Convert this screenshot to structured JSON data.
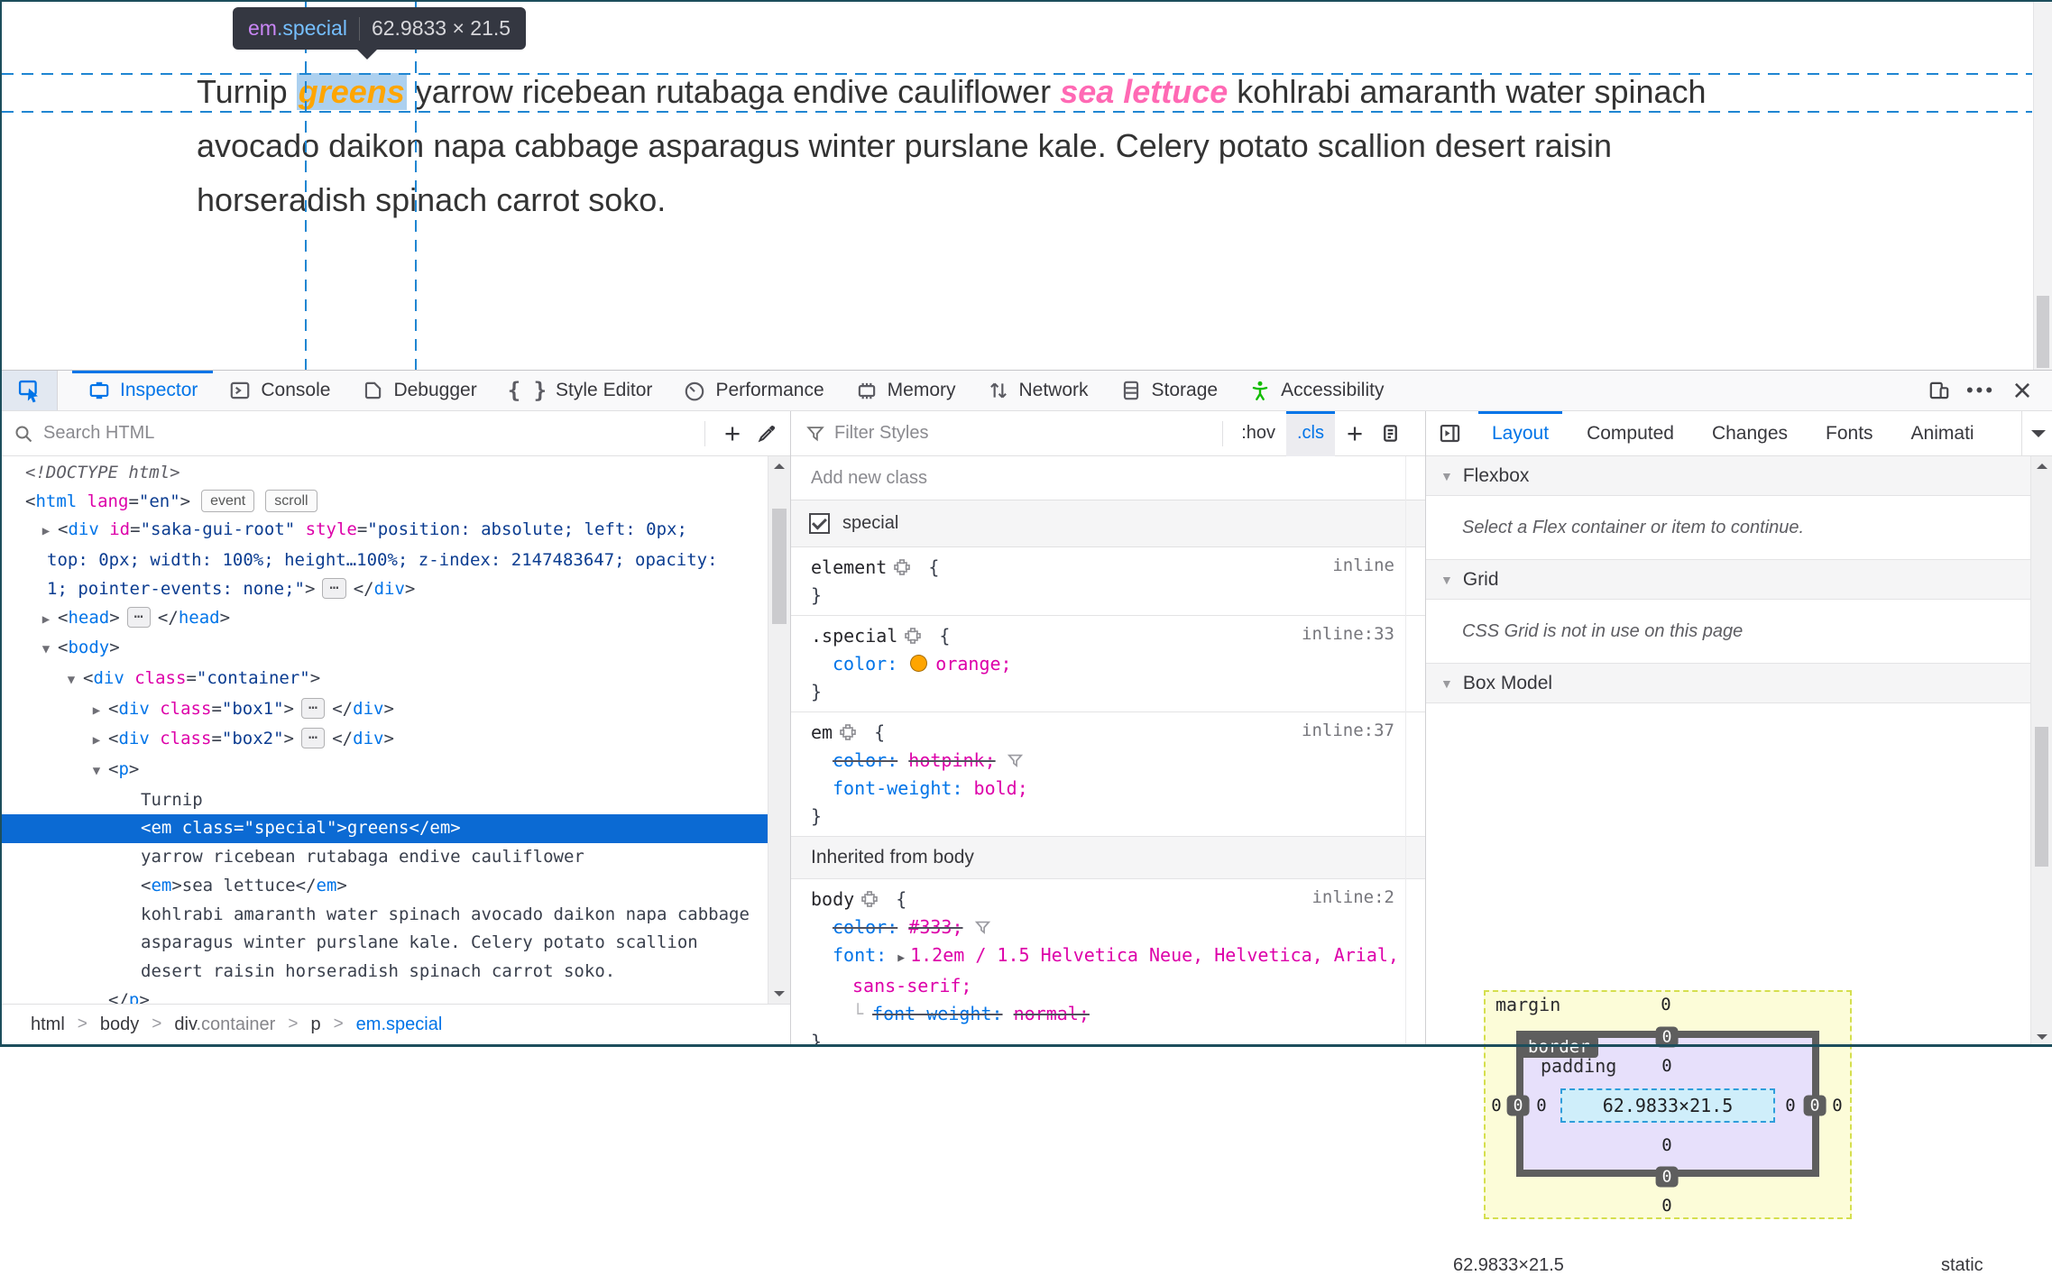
{
  "colors": {
    "accent": "#0074e8",
    "selection_bg": "#0b6ad3",
    "guide_blue": "#1f86d2",
    "tag": "#0074e8",
    "attr_name": "#dd00a9",
    "attr_value": "#0c3d91",
    "prop_name": "#0074e8",
    "prop_value": "#dd00a9",
    "orange_swatch": "#ffa500",
    "hotpink_text": "#ff69b4",
    "special_text": "#ffa500",
    "body_text": "#333333",
    "accessibility_green": "#12bc00",
    "bm_margin_fill": "#fcfcd8",
    "bm_border_fill": "#5e5e5e",
    "bm_padding_fill": "#e7e0fb",
    "bm_content_fill": "#cfeefa"
  },
  "page": {
    "tooltip": {
      "tag": "em",
      "cls": ".special",
      "dims": "62.9833 × 21.5"
    },
    "text_lines": [
      {
        "segments": [
          {
            "t": "Turnip ",
            "c": "plain"
          },
          {
            "t": "greens",
            "c": "special"
          },
          {
            "t": " yarrow ricebean rutabaga endive cauliflower ",
            "c": "plain"
          },
          {
            "t": "sea lettuce",
            "c": "em"
          },
          {
            "t": " kohlrabi amaranth water spinach",
            "c": "plain"
          }
        ]
      },
      {
        "segments": [
          {
            "t": "avocado daikon napa cabbage asparagus winter purslane kale. Celery potato scallion desert raisin",
            "c": "plain"
          }
        ]
      },
      {
        "segments": [
          {
            "t": "horseradish spinach carrot soko.",
            "c": "plain"
          }
        ]
      }
    ]
  },
  "toolbar": {
    "tabs": [
      {
        "id": "inspector",
        "label": "Inspector",
        "icon": "inspector-icon",
        "active": true
      },
      {
        "id": "console",
        "label": "Console",
        "icon": "console-icon"
      },
      {
        "id": "debugger",
        "label": "Debugger",
        "icon": "debugger-icon"
      },
      {
        "id": "style-editor",
        "label": "Style Editor",
        "icon": "style-editor-icon"
      },
      {
        "id": "performance",
        "label": "Performance",
        "icon": "performance-icon"
      },
      {
        "id": "memory",
        "label": "Memory",
        "icon": "memory-icon"
      },
      {
        "id": "network",
        "label": "Network",
        "icon": "network-icon"
      },
      {
        "id": "storage",
        "label": "Storage",
        "icon": "storage-icon"
      },
      {
        "id": "accessibility",
        "label": "Accessibility",
        "icon": "accessibility-icon",
        "icon_color": "#12bc00"
      }
    ],
    "right_icons": [
      {
        "name": "responsive-mode-icon"
      },
      {
        "name": "menu-icon",
        "glyph": "•••"
      },
      {
        "name": "close-icon",
        "glyph": "×"
      }
    ]
  },
  "markup": {
    "search_placeholder": "Search HTML",
    "add_node_label": "+",
    "rows": [
      {
        "i": 0,
        "s": [
          {
            "c": "d",
            "t": "<!DOCTYPE html>"
          }
        ]
      },
      {
        "i": 0,
        "s": [
          {
            "c": "p",
            "t": "<"
          },
          {
            "c": "t",
            "t": "html"
          },
          {
            "c": "p",
            "t": " "
          },
          {
            "c": "a",
            "t": "lang"
          },
          {
            "c": "p",
            "t": "="
          },
          {
            "c": "v",
            "t": "\"en\""
          },
          {
            "c": "p",
            "t": ">"
          },
          {
            "c": "b",
            "t": "event"
          },
          {
            "c": "b",
            "t": "scroll"
          }
        ]
      },
      {
        "i": 1,
        "tw": "c",
        "s": [
          {
            "c": "p",
            "t": "<"
          },
          {
            "c": "t",
            "t": "div"
          },
          {
            "c": "p",
            "t": " "
          },
          {
            "c": "a",
            "t": "id"
          },
          {
            "c": "p",
            "t": "="
          },
          {
            "c": "v",
            "t": "\"saka-gui-root\""
          },
          {
            "c": "p",
            "t": " "
          },
          {
            "c": "a",
            "t": "style"
          },
          {
            "c": "p",
            "t": "="
          },
          {
            "c": "v",
            "t": "\"position: absolute; left: 0px;"
          }
        ]
      },
      {
        "i": "w",
        "s": [
          {
            "c": "v",
            "t": "top: 0px; width: 100%; height…100%; z-index: 2147483647; opacity:"
          }
        ]
      },
      {
        "i": "w",
        "s": [
          {
            "c": "v",
            "t": "1; pointer-events: none;\""
          },
          {
            "c": "p",
            "t": ">"
          },
          {
            "c": "e",
            "t": "⋯"
          },
          {
            "c": "p",
            "t": "</"
          },
          {
            "c": "t",
            "t": "div"
          },
          {
            "c": "p",
            "t": ">"
          }
        ]
      },
      {
        "i": 1,
        "tw": "c",
        "s": [
          {
            "c": "p",
            "t": "<"
          },
          {
            "c": "t",
            "t": "head"
          },
          {
            "c": "p",
            "t": ">"
          },
          {
            "c": "e",
            "t": "⋯"
          },
          {
            "c": "p",
            "t": "</"
          },
          {
            "c": "t",
            "t": "head"
          },
          {
            "c": "p",
            "t": ">"
          }
        ]
      },
      {
        "i": 1,
        "tw": "e",
        "s": [
          {
            "c": "p",
            "t": "<"
          },
          {
            "c": "t",
            "t": "body"
          },
          {
            "c": "p",
            "t": ">"
          }
        ]
      },
      {
        "i": 2,
        "tw": "e",
        "s": [
          {
            "c": "p",
            "t": "<"
          },
          {
            "c": "t",
            "t": "div"
          },
          {
            "c": "p",
            "t": " "
          },
          {
            "c": "a",
            "t": "class"
          },
          {
            "c": "p",
            "t": "="
          },
          {
            "c": "v",
            "t": "\"container\""
          },
          {
            "c": "p",
            "t": ">"
          }
        ]
      },
      {
        "i": 3,
        "tw": "c",
        "s": [
          {
            "c": "p",
            "t": "<"
          },
          {
            "c": "t",
            "t": "div"
          },
          {
            "c": "p",
            "t": " "
          },
          {
            "c": "a",
            "t": "class"
          },
          {
            "c": "p",
            "t": "="
          },
          {
            "c": "v",
            "t": "\"box1\""
          },
          {
            "c": "p",
            "t": ">"
          },
          {
            "c": "e",
            "t": "⋯"
          },
          {
            "c": "p",
            "t": "</"
          },
          {
            "c": "t",
            "t": "div"
          },
          {
            "c": "p",
            "t": ">"
          }
        ]
      },
      {
        "i": 3,
        "tw": "c",
        "s": [
          {
            "c": "p",
            "t": "<"
          },
          {
            "c": "t",
            "t": "div"
          },
          {
            "c": "p",
            "t": " "
          },
          {
            "c": "a",
            "t": "class"
          },
          {
            "c": "p",
            "t": "="
          },
          {
            "c": "v",
            "t": "\"box2\""
          },
          {
            "c": "p",
            "t": ">"
          },
          {
            "c": "e",
            "t": "⋯"
          },
          {
            "c": "p",
            "t": "</"
          },
          {
            "c": "t",
            "t": "div"
          },
          {
            "c": "p",
            "t": ">"
          }
        ]
      },
      {
        "i": 3,
        "tw": "e",
        "s": [
          {
            "c": "p",
            "t": "<"
          },
          {
            "c": "t",
            "t": "p"
          },
          {
            "c": "p",
            "t": ">"
          }
        ]
      },
      {
        "i": 4,
        "s": [
          {
            "c": "x",
            "t": "Turnip"
          }
        ]
      },
      {
        "i": 4,
        "sel": true,
        "s": [
          {
            "c": "p",
            "t": "<"
          },
          {
            "c": "t",
            "t": "em"
          },
          {
            "c": "p",
            "t": " "
          },
          {
            "c": "a",
            "t": "class"
          },
          {
            "c": "p",
            "t": "="
          },
          {
            "c": "v",
            "t": "\"special\""
          },
          {
            "c": "p",
            "t": ">"
          },
          {
            "c": "x",
            "t": "greens"
          },
          {
            "c": "p",
            "t": "</"
          },
          {
            "c": "t",
            "t": "em"
          },
          {
            "c": "p",
            "t": ">"
          }
        ]
      },
      {
        "i": 4,
        "s": [
          {
            "c": "x",
            "t": "yarrow ricebean rutabaga endive cauliflower"
          }
        ]
      },
      {
        "i": 4,
        "s": [
          {
            "c": "p",
            "t": "<"
          },
          {
            "c": "t",
            "t": "em"
          },
          {
            "c": "p",
            "t": ">"
          },
          {
            "c": "x",
            "t": "sea lettuce"
          },
          {
            "c": "p",
            "t": "</"
          },
          {
            "c": "t",
            "t": "em"
          },
          {
            "c": "p",
            "t": ">"
          }
        ]
      },
      {
        "i": 4,
        "s": [
          {
            "c": "x",
            "t": "kohlrabi amaranth water spinach avocado daikon napa cabbage"
          }
        ]
      },
      {
        "i": 4,
        "s": [
          {
            "c": "x",
            "t": "asparagus winter purslane kale. Celery potato scallion"
          }
        ]
      },
      {
        "i": 4,
        "s": [
          {
            "c": "x",
            "t": "desert raisin horseradish spinach carrot soko."
          }
        ]
      },
      {
        "i": 3,
        "s": [
          {
            "c": "p",
            "t": "</"
          },
          {
            "c": "t",
            "t": "p"
          },
          {
            "c": "p",
            "t": ">"
          }
        ]
      }
    ]
  },
  "breadcrumbs": [
    {
      "label": "html"
    },
    {
      "label": "body"
    },
    {
      "label": "div",
      "suffix": ".container"
    },
    {
      "label": "p"
    },
    {
      "label": "em.special",
      "active": true
    }
  ],
  "styles": {
    "filter_placeholder": "Filter Styles",
    "pseudo_toggle": ":hov",
    "class_toggle": ".cls",
    "new_rule_label": "+",
    "add_class_placeholder": "Add new class",
    "class_checkbox": {
      "label": "special",
      "checked": true
    },
    "rules": [
      {
        "selector": "element",
        "location": "inline",
        "decls": []
      },
      {
        "selector": ".special",
        "location": "inline:33",
        "decls": [
          {
            "name": "color",
            "value": "orange;",
            "swatch": "#ffa500"
          }
        ]
      },
      {
        "selector": "em",
        "location": "inline:37",
        "decls": [
          {
            "name": "color",
            "value": "hotpink;",
            "struck": true,
            "funnel": true
          },
          {
            "name": "font-weight",
            "value": "bold;"
          }
        ]
      }
    ],
    "inherited": {
      "header": "Inherited from body",
      "rules": [
        {
          "selector": "body",
          "location": "inline:2",
          "decls": [
            {
              "name": "color",
              "value": "#333;",
              "struck": true,
              "funnel": true
            },
            {
              "name": "font",
              "value": "1.2em / 1.5 Helvetica Neue, Helvetica, Arial,",
              "value2": "sans-serif;",
              "expander": true
            },
            {
              "name": "font-weight",
              "value": "normal;",
              "struck": true,
              "computed": true
            }
          ]
        }
      ]
    }
  },
  "layout_panel": {
    "tabs": [
      {
        "label": "Layout",
        "active": true
      },
      {
        "label": "Computed"
      },
      {
        "label": "Changes"
      },
      {
        "label": "Fonts"
      },
      {
        "label": "Animati"
      }
    ],
    "sections": {
      "flexbox": {
        "title": "Flexbox",
        "message": "Select a Flex container or item to continue."
      },
      "grid": {
        "title": "Grid",
        "message": "CSS Grid is not in use on this page"
      },
      "boxmodel": {
        "title": "Box Model"
      }
    },
    "box_model": {
      "margin_label": "margin",
      "border_label": "border",
      "padding_label": "padding",
      "margin": {
        "top": "0",
        "right": "0",
        "bottom": "0",
        "left": "0"
      },
      "border": {
        "top": "0",
        "right": "0",
        "bottom": "0",
        "left": "0"
      },
      "padding": {
        "top": "0",
        "right": "0",
        "bottom": "0",
        "left": "0"
      },
      "content": "62.9833×21.5",
      "footer": {
        "size": "62.9833×21.5",
        "position": "static"
      }
    }
  }
}
